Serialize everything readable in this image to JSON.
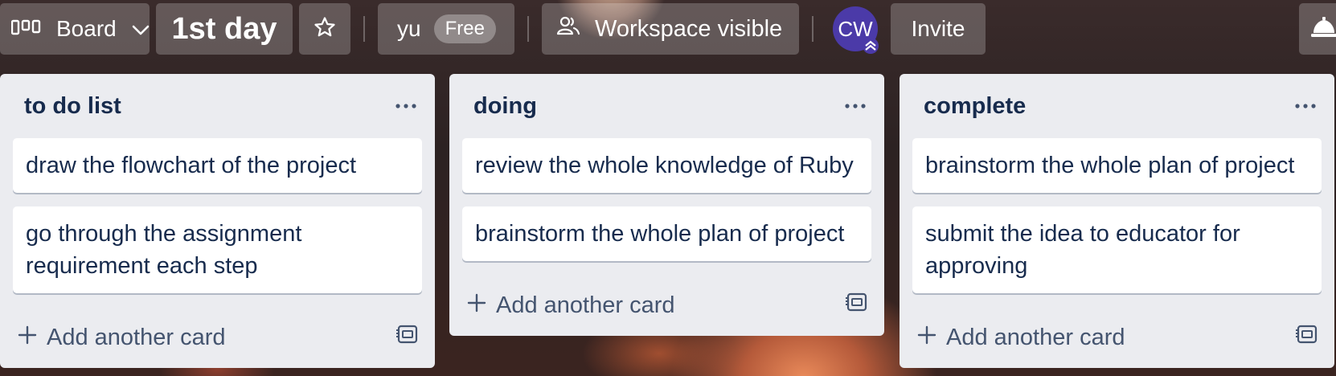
{
  "toolbar": {
    "view_label": "Board",
    "board_title": "1st day",
    "workspace_name": "yu",
    "plan_badge": "Free",
    "visibility_label": "Workspace visible",
    "avatar_initials": "CW",
    "invite_label": "Invite"
  },
  "colors": {
    "list_bg": "#ebecf0",
    "card_text": "#172b4d",
    "avatar_bg": "#4b3aa8"
  },
  "icons": [
    "board-icon",
    "chevron-down-icon",
    "star-icon",
    "people-icon",
    "admin-chevron-icon",
    "bell-icon",
    "more-icon",
    "plus-icon",
    "template-icon"
  ],
  "lists": [
    {
      "title": "to do list",
      "cards": [
        "draw the flowchart of the project",
        "go through the assignment requirement each step"
      ],
      "add_label": "Add another card"
    },
    {
      "title": "doing",
      "cards": [
        "review the whole knowledge of Ruby",
        "brainstorm the whole plan of project"
      ],
      "add_label": "Add another card"
    },
    {
      "title": "complete",
      "cards": [
        "brainstorm the whole plan of project",
        "submit the idea to educator for approving"
      ],
      "add_label": "Add another card"
    }
  ]
}
